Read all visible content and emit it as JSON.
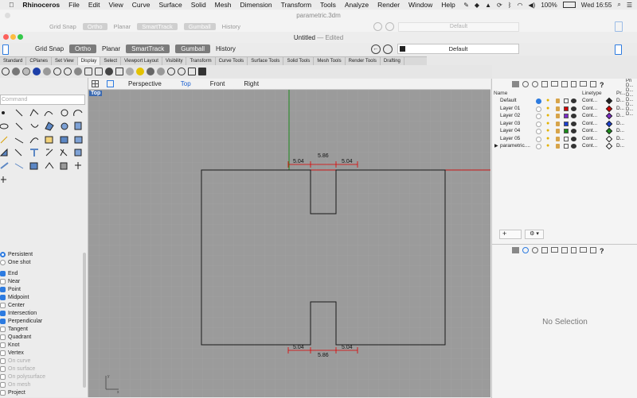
{
  "menubar": {
    "apple": "",
    "app_name": "Rhinoceros",
    "items": [
      "File",
      "Edit",
      "View",
      "Curve",
      "Surface",
      "Solid",
      "Mesh",
      "Dimension",
      "Transform",
      "Tools",
      "Analyze",
      "Render",
      "Window",
      "Help"
    ],
    "battery": "100%",
    "clock": "Wed 16:55"
  },
  "ghost_window": {
    "title": "parametric.3dm",
    "buttons": [
      "Grid Snap",
      "Ortho",
      "Planar",
      "SmartTrack",
      "Gumball",
      "History"
    ],
    "layer": "Default"
  },
  "window": {
    "title": "Untitled",
    "status": "Edited"
  },
  "toolbar": {
    "grid_snap": "Grid Snap",
    "ortho": "Ortho",
    "planar": "Planar",
    "smarttrack": "SmartTrack",
    "gumball": "Gumball",
    "history": "History",
    "current_layer": "Default"
  },
  "tabs": [
    "Standard",
    "CPlanes",
    "Set View",
    "Display",
    "Select",
    "Viewport Layout",
    "Visibility",
    "Transform",
    "Curve Tools",
    "Surface Tools",
    "Solid Tools",
    "Mesh Tools",
    "Render Tools",
    "Drafting"
  ],
  "active_tab": "Display",
  "command": {
    "placeholder": "Command"
  },
  "viewport_tabs": [
    "Perspective",
    "Top",
    "Front",
    "Right"
  ],
  "active_viewport": "Top",
  "viewport_label": "Top",
  "dimensions": {
    "top_left": "5.04",
    "top_middle": "5.86",
    "top_right": "5.04",
    "bottom_left": "5.04",
    "bottom_middle": "5.86",
    "bottom_right": "5.04"
  },
  "osnap": {
    "modes": [
      {
        "label": "Persistent",
        "type": "radio",
        "checked": true
      },
      {
        "label": "One shot",
        "type": "radio",
        "checked": false
      }
    ],
    "snaps": [
      {
        "label": "End",
        "checked": true
      },
      {
        "label": "Near",
        "checked": false
      },
      {
        "label": "Point",
        "checked": true
      },
      {
        "label": "Midpoint",
        "checked": true
      },
      {
        "label": "Center",
        "checked": false
      },
      {
        "label": "Intersection",
        "checked": true
      },
      {
        "label": "Perpendicular",
        "checked": true
      },
      {
        "label": "Tangent",
        "checked": false
      },
      {
        "label": "Quadrant",
        "checked": false
      },
      {
        "label": "Knot",
        "checked": false
      },
      {
        "label": "Vertex",
        "checked": false
      },
      {
        "label": "On curve",
        "checked": false,
        "disabled": true
      },
      {
        "label": "On surface",
        "checked": false,
        "disabled": true
      },
      {
        "label": "On polysurface",
        "checked": false,
        "disabled": true
      },
      {
        "label": "On mesh",
        "checked": false,
        "disabled": true
      },
      {
        "label": "Project",
        "checked": false
      }
    ]
  },
  "layers": {
    "header_name": "Name",
    "header_linetype": "Linetype",
    "header_print": "Pr...",
    "rows": [
      {
        "name": "Default",
        "current": true,
        "color": "#ffffff",
        "linetype": "Cont...",
        "print": "D..."
      },
      {
        "name": "Layer 01",
        "current": false,
        "color": "#d10000",
        "linetype": "Cont...",
        "print": "D..."
      },
      {
        "name": "Layer 02",
        "current": false,
        "color": "#7c2bc8",
        "linetype": "Cont...",
        "print": "D..."
      },
      {
        "name": "Layer 03",
        "current": false,
        "color": "#1a3fd0",
        "linetype": "Cont...",
        "print": "D..."
      },
      {
        "name": "Layer 04",
        "current": false,
        "color": "#1a8a1a",
        "linetype": "Cont...",
        "print": "D..."
      },
      {
        "name": "Layer 05",
        "current": false,
        "color": "#ffffff",
        "linetype": "Cont...",
        "print": "D..."
      },
      {
        "name": "parametric....",
        "current": false,
        "color": "#ffffff",
        "linetype": "Cont...",
        "print": "D...",
        "expandable": true
      }
    ]
  },
  "properties": {
    "empty_text": "No Selection"
  },
  "far_right": {
    "header": "Pri",
    "values": [
      "D...",
      "D...",
      "D...",
      "D...",
      "D...",
      "D...",
      "D..."
    ]
  },
  "colors": {
    "accent": "#2d7be0",
    "viewport_bg": "#9b9b9b",
    "dimension": "#e00000",
    "geometry": "#1a1a1a",
    "x_axis": "#c81414",
    "y_axis": "#1e8a1e"
  }
}
